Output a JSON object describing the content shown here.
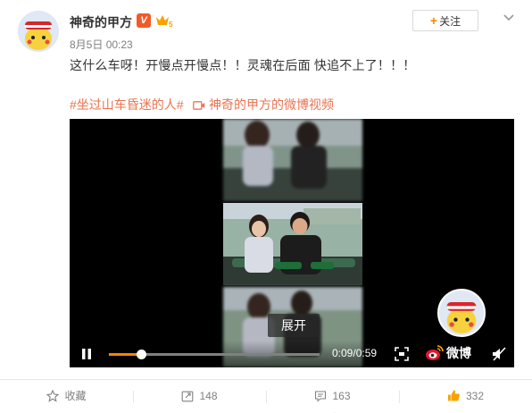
{
  "post": {
    "username": "神奇的甲方",
    "verified_badge": "V",
    "level_badge_icon": "vip-level-5-icon",
    "follow_label": "关注",
    "date": "8月5日",
    "time": "00:23",
    "text": "这什么车呀！开慢点开慢点！！灵魂在后面 快追不上了！！！",
    "topic": "#坐过山车昏迷的人#",
    "video_link": "神奇的甲方的微博视频"
  },
  "video": {
    "expand_label": "展开",
    "current_time": "0:09",
    "duration": "0:59",
    "progress_fraction": 0.153,
    "brand": "微博"
  },
  "actions": {
    "favorite_label": "收藏",
    "repost_count": "148",
    "comment_count": "163",
    "like_count": "332"
  },
  "colors": {
    "accent": "#ff8200",
    "link": "#eb7350",
    "verified": "#f25a2a"
  }
}
